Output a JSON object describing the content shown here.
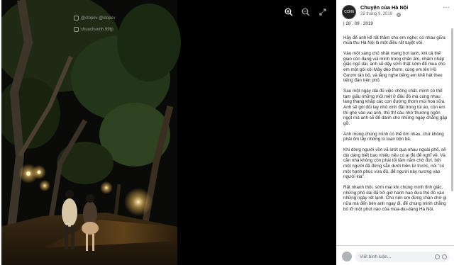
{
  "photo": {
    "watermark_handle": "@ctopcv  @ctopcv",
    "watermark_sub": "chuuchuvnh.99tp",
    "alt_caption": "Night street scene with trees and a couple walking"
  },
  "toolbar": {
    "zoom_in_icon": "zoom-in-icon",
    "zoom_out_icon": "zoom-out-icon",
    "fullscreen_icon": "fullscreen-icon"
  },
  "post": {
    "page_name": "Chuyện của Hà Nội",
    "avatar_text": "CCHN",
    "date": "28 tháng 9, 2019 ·",
    "privacy_icon": "globe-icon",
    "more_label": "···",
    "paragraphs": [
      "| 28 . 09 . 2019",
      "Hãy để anh kể rất thầm cho em nghe: có nhau giữa mùa thu Hà Nội là một điều rất tuyệt vời.",
      "Vào một sáng chủ nhật mang hơi lạnh, khi cả thế gian còn đang vùi mình trong chăn ấm, nhâm nhấp giấc ngủ dài, anh sẽ dậy sớm thật sớm để mua cho em một gói xôi Mây dẻo thơm, cùng em lên Hồ Gươm tản bộ, và lắng nghe tiếng em khẽ hát theo tiếng đàn trên phố.",
      "Sau một ngày dài đủ việc chồng chất, mình có thể tạm giấu những mỏi mệt ở đâu đó mà cùng nhau lang thang khắp các con đường thơm mùi hoa sữa. Anh sẽ gói đôi tay nhỏ xinh đặt trong túi áo, còn em thì ghé vào vai anh, thủ thỉ câu nhớ thương ngôn ngọt mà anh sẽ để dành cho những ngày chẳng gặp gỡ.",
      "Anh mong chúng mình có thể ôm nhau, chứ không phải ôm lấy những lo toan bộn bề.",
      "Khi dòng người vồn vã lướt qua nhau ngoài phố, sẽ dịu dàng biết bao nhiêu nếu có ai đó để nghĩ về. Và căn nhà không còn phải tối tăm nắm chờ đợi, bởi một người đã đứng sẵn dưới hiên từ trước, nói \"có một hạnh phúc vừa đủ, để người này nương vào người kia\".",
      "Rất nhanh thôi, sớm mai khi chúng mình tỉnh giấc, những phố dài đã trở giờ hanh hao đưa thủ đô vào những ngày rét lạnh. Cho nên em đừng chần chờ gì nữa mà đến bên anh ngay đi, để chúng mình chẳng bỏ lỡ một phút nào của mùa-dịu-dàng Hà Nội."
    ]
  },
  "comment": {
    "placeholder": "Viết bình luận..."
  },
  "colors": {
    "panel_bg": "#ffffff",
    "text": "#1c1e21",
    "muted": "#65676b",
    "input_bg": "#f0f2f5"
  }
}
